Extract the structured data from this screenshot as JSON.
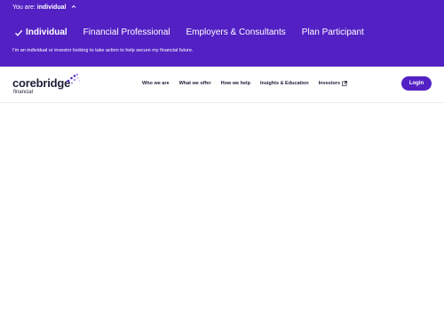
{
  "persona_selector": {
    "prefix": "You are:",
    "value": "individual",
    "chevron_icon": "chevron-up-icon"
  },
  "audience_tabs": [
    {
      "label": "Individual",
      "active": true,
      "icon": "checkmark-icon"
    },
    {
      "label": "Financial Professional",
      "active": false
    },
    {
      "label": "Employers & Consultants",
      "active": false
    },
    {
      "label": "Plan Participant",
      "active": false
    }
  ],
  "audience_description": "I'm an individual or investor looking to take action to help secure my financial future.",
  "header": {
    "logo": {
      "wordmark": "corebridge",
      "subtext": "financial",
      "icon": "corebridge-dots-logo"
    },
    "nav": [
      {
        "label": "Who we are"
      },
      {
        "label": "What we offer"
      },
      {
        "label": "How we help"
      },
      {
        "label": "Insights & Education"
      },
      {
        "label": "Investors",
        "icon": "external-link-icon"
      }
    ],
    "login_label": "Login"
  },
  "colors": {
    "brand_purple": "#5320c4",
    "text_dark": "#1d1e3a",
    "white": "#ffffff"
  }
}
